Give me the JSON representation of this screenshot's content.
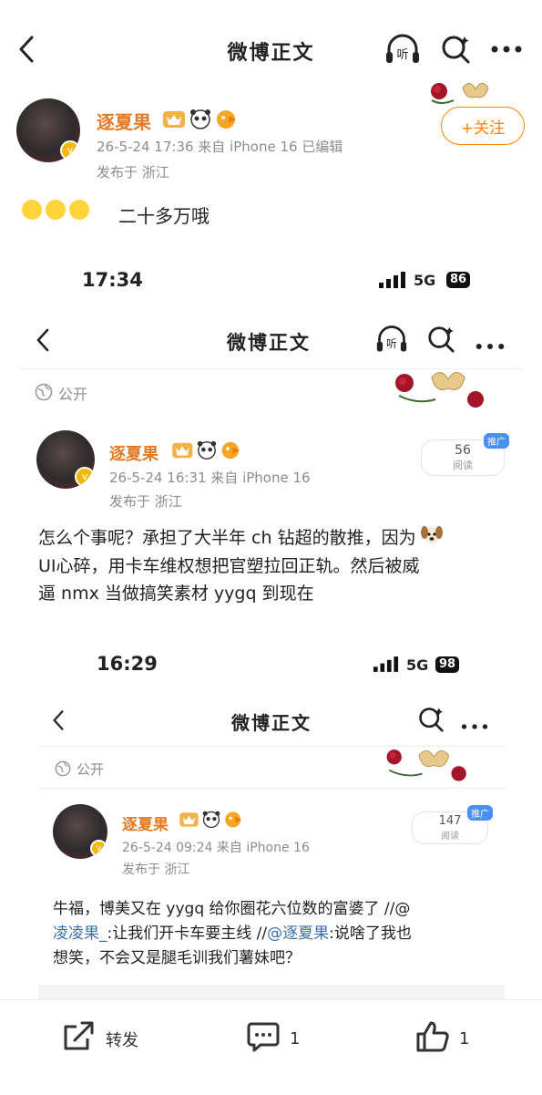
{
  "top_nav": {
    "title": "微博正文"
  },
  "post": {
    "username": "逐夏果",
    "meta": "26-5-24 17:36  来自 iPhone 16  已编辑",
    "location": "发布于 浙江",
    "follow_label": "+关注",
    "text": "二十多万哦"
  },
  "shot1": {
    "time": "17:34",
    "network": "5G",
    "battery": "86",
    "nav_title": "微博正文",
    "visibility": "公开",
    "username": "逐夏果",
    "meta": "26-5-24 16:31  来自 iPhone 16",
    "location": "发布于 浙江",
    "reads": "56",
    "reads_label": "阅读",
    "promo": "推广",
    "text_line1": "怎么个事呢？承担了大半年 ch 钻超的散推，因为",
    "text_line2": "UI心碎，用卡车维权想把官塑拉回正轨。然后被威",
    "text_line3": "逼 nmx 当做搞笑素材 yygq 到现在"
  },
  "shot2": {
    "time": "16:29",
    "network": "5G",
    "battery": "98",
    "nav_title": "微博正文",
    "visibility": "公开",
    "username": "逐夏果",
    "meta": "26-5-24 09:24  来自 iPhone 16",
    "location": "发布于 浙江",
    "reads": "147",
    "reads_label": "阅读",
    "promo": "推广",
    "text_a": "牛福，博美又在 yygq 给你圈花六位数的富婆了 //@",
    "mention1": "凌凌果_",
    "text_b": ":让我们开卡车要主线 //",
    "mention2": "@逐夏果",
    "text_c": ":说啥了我也",
    "text_d": "想笑，不会又是腿毛训我们薯妹吧？"
  },
  "bottom_bar": {
    "repost_label": "转发",
    "comment_count": "1",
    "like_count": "1"
  },
  "colors": {
    "accent": "#ff8200",
    "username": "#e47b24",
    "mention": "#3b6fb2",
    "meta": "#8c8c8c"
  }
}
